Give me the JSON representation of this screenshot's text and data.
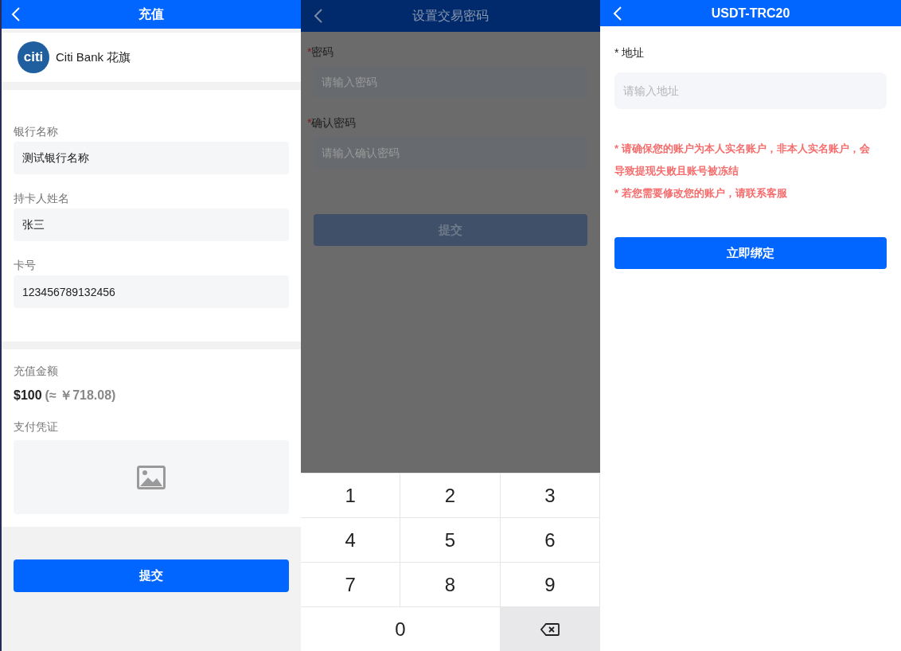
{
  "recharge": {
    "title": "充值",
    "bank": {
      "logo_text": "citi",
      "name": "Citi Bank 花旗"
    },
    "fields": [
      {
        "label": "银行名称",
        "value": "测试银行名称"
      },
      {
        "label": "持卡人姓名",
        "value": "张三"
      },
      {
        "label": "卡号",
        "value": "123456789132456"
      }
    ],
    "amount": {
      "label": "充值金额",
      "value": "$100",
      "converted": "(≈ ￥718.08)"
    },
    "voucher": {
      "label": "支付凭证"
    },
    "submit": "提交"
  },
  "password": {
    "title": "设置交易密码",
    "fields": [
      {
        "mark": "*",
        "label": "密码",
        "placeholder": "请输入密码"
      },
      {
        "mark": "*",
        "label": "确认密码",
        "placeholder": "请输入确认密码"
      }
    ],
    "submit": "提交",
    "keypad": [
      {
        "kind": "digit",
        "label": "1"
      },
      {
        "kind": "digit",
        "label": "2"
      },
      {
        "kind": "digit",
        "label": "3"
      },
      {
        "kind": "digit",
        "label": "4"
      },
      {
        "kind": "digit",
        "label": "5"
      },
      {
        "kind": "digit",
        "label": "6"
      },
      {
        "kind": "digit",
        "label": "7"
      },
      {
        "kind": "digit",
        "label": "8"
      },
      {
        "kind": "digit",
        "label": "9"
      },
      {
        "kind": "wide-digit",
        "label": "0"
      },
      {
        "kind": "delete"
      }
    ]
  },
  "bind": {
    "title": "USDT-TRC20",
    "field": {
      "label": "* 地址",
      "placeholder": "请输入地址"
    },
    "notes": [
      "* 请确保您的账户为本人实名账户，非本人实名账户，会导致提现失败且账号被冻结",
      "* 若您需要修改您的账户，请联系客服"
    ],
    "submit": "立即绑定"
  }
}
